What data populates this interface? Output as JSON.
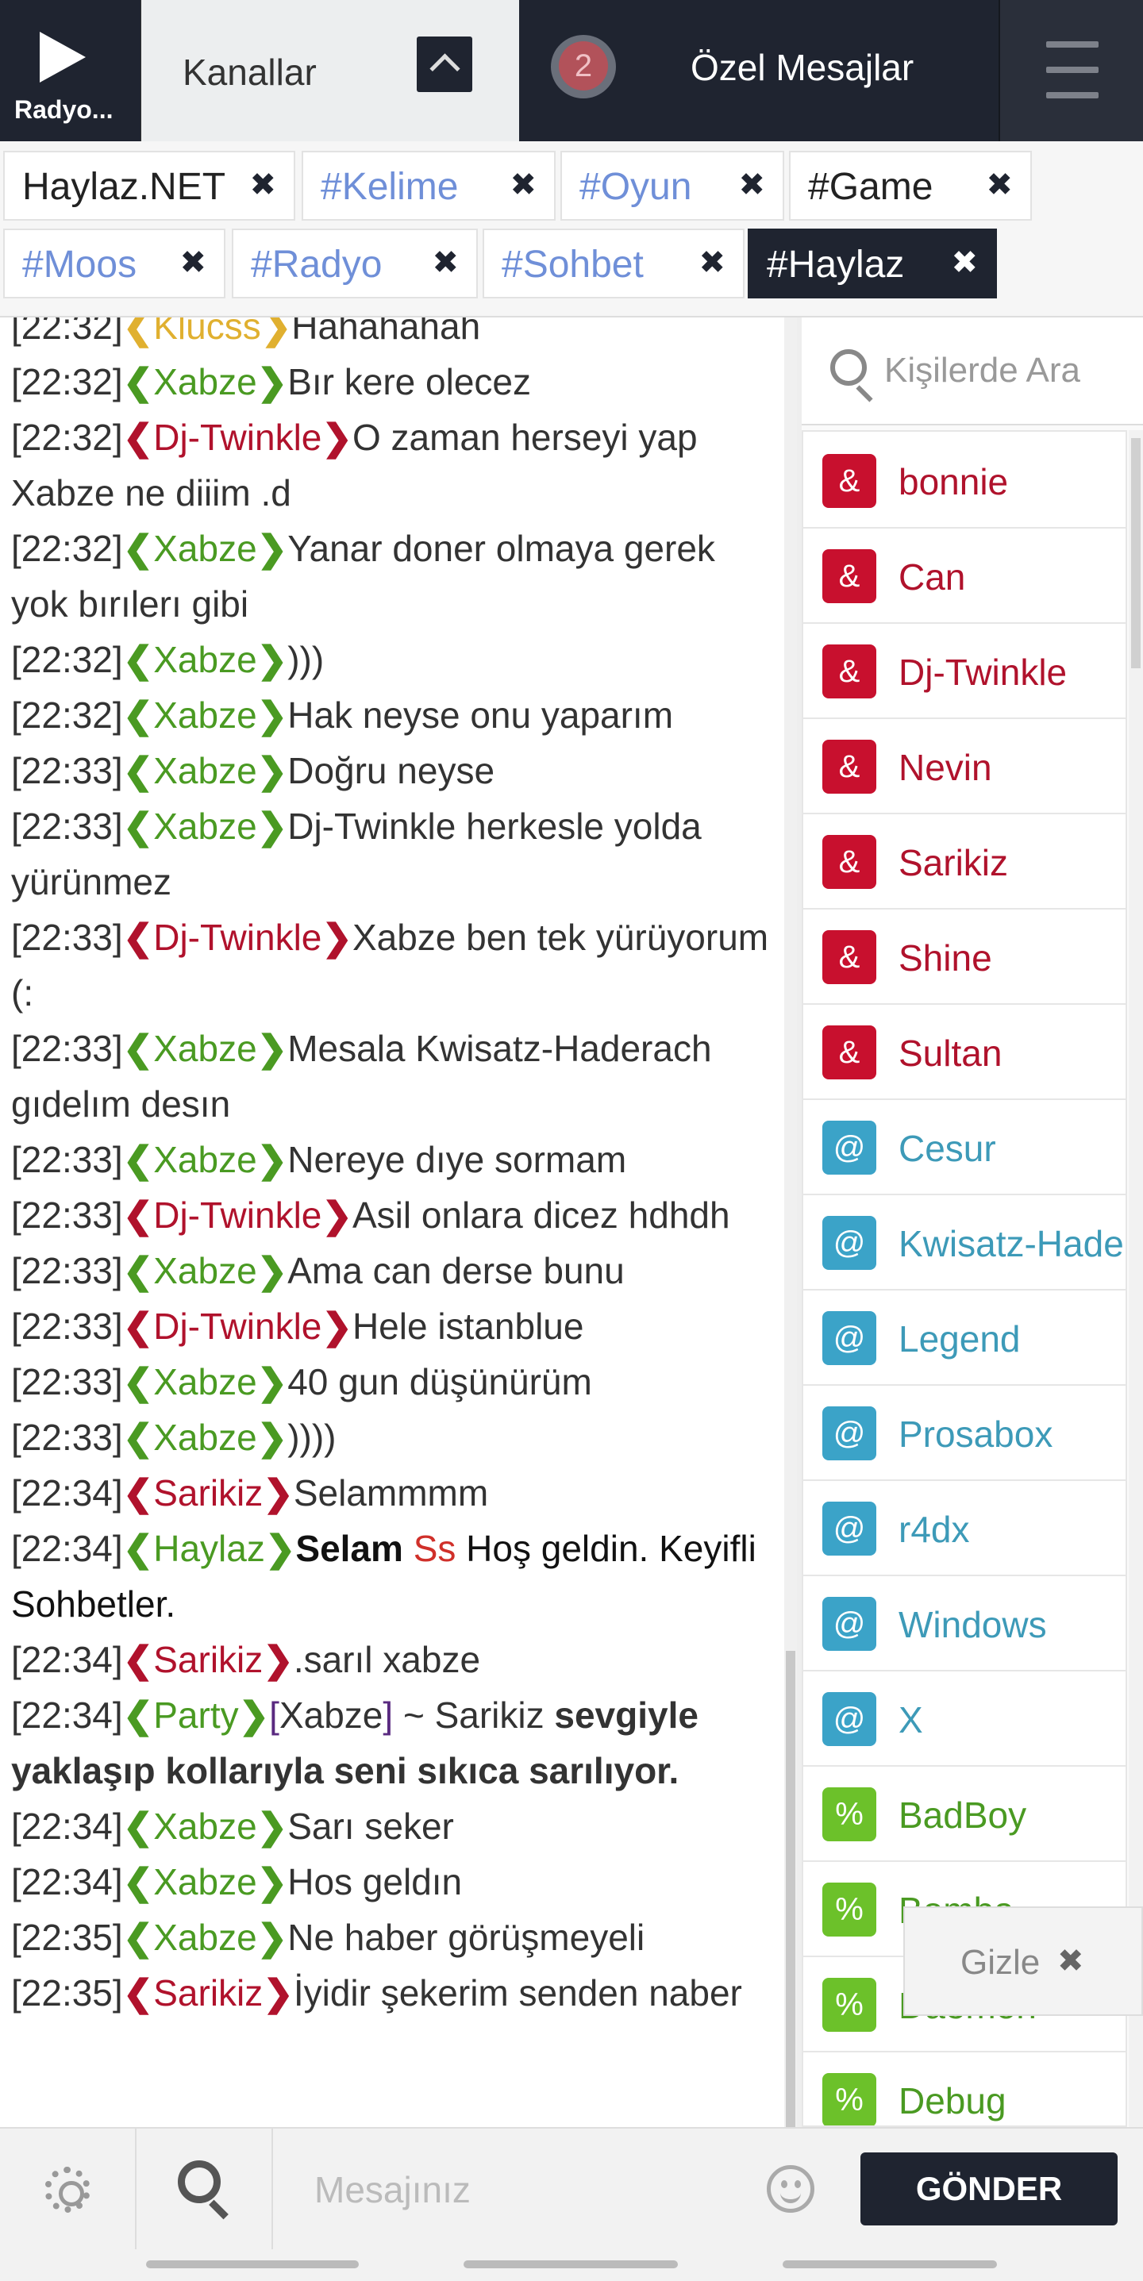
{
  "header": {
    "radio_label": "Radyo...",
    "channels_label": "Kanallar",
    "pm_badge": "2",
    "pm_label": "Özel Mesajlar"
  },
  "channel_tabs": [
    {
      "name": "Haylaz.NET",
      "close": "✖",
      "color": "#222222",
      "active": false
    },
    {
      "name": "#Kelime",
      "close": "✖",
      "color": "#6f8fd8",
      "active": false
    },
    {
      "name": "#Oyun",
      "close": "✖",
      "color": "#6f8fd8",
      "active": false
    },
    {
      "name": "#Game",
      "close": "✖",
      "color": "#222222",
      "active": false
    },
    {
      "name": "#Moos",
      "close": "✖",
      "color": "#6f8fd8",
      "active": false
    },
    {
      "name": "#Radyo",
      "close": "✖",
      "color": "#6f8fd8",
      "active": false
    },
    {
      "name": "#Sohbet",
      "close": "✖",
      "color": "#6f8fd8",
      "active": false
    },
    {
      "name": "#Haylaz",
      "close": "✖",
      "color": "#ffffff",
      "active": true
    }
  ],
  "messages": [
    {
      "time": "[22:32]",
      "nick": "Klucss",
      "nick_color": "yellow",
      "text": "Hahahahah"
    },
    {
      "time": "[22:32]",
      "nick": "Xabze",
      "nick_color": "green",
      "text": "Bır kere olecez"
    },
    {
      "time": "[22:32]",
      "nick": "Dj-Twinkle",
      "nick_color": "red",
      "text": "O zaman herseyi yap Xabze ne diiim .d"
    },
    {
      "time": "[22:32]",
      "nick": "Xabze",
      "nick_color": "green",
      "text": "Yanar doner olmaya gerek yok bırılerı gibi"
    },
    {
      "time": "[22:32]",
      "nick": "Xabze",
      "nick_color": "green",
      "text": ")))"
    },
    {
      "time": "[22:32]",
      "nick": "Xabze",
      "nick_color": "green",
      "text": "Hak neyse onu yaparım"
    },
    {
      "time": "[22:33]",
      "nick": "Xabze",
      "nick_color": "green",
      "text": "Doğru neyse"
    },
    {
      "time": "[22:33]",
      "nick": "Xabze",
      "nick_color": "green",
      "text": "Dj-Twinkle  herkesle yolda yürünmez"
    },
    {
      "time": "[22:33]",
      "nick": "Dj-Twinkle",
      "nick_color": "red",
      "text": "Xabze ben tek yürüyorum (:"
    },
    {
      "time": "[22:33]",
      "nick": "Xabze",
      "nick_color": "green",
      "text": "Mesala Kwisatz-Haderach gıdelım desın"
    },
    {
      "time": "[22:33]",
      "nick": "Xabze",
      "nick_color": "green",
      "text": "Nereye dıye sormam"
    },
    {
      "time": "[22:33]",
      "nick": "Dj-Twinkle",
      "nick_color": "red",
      "text": "Asil onlara dicez hdhdh"
    },
    {
      "time": "[22:33]",
      "nick": "Xabze",
      "nick_color": "green",
      "text": "Ama can derse bunu"
    },
    {
      "time": "[22:33]",
      "nick": "Dj-Twinkle",
      "nick_color": "red",
      "text": "Hele istanblue"
    },
    {
      "time": "[22:33]",
      "nick": "Xabze",
      "nick_color": "green",
      "text": "40 gun düşünürüm"
    },
    {
      "time": "[22:33]",
      "nick": "Xabze",
      "nick_color": "green",
      "text": "))))"
    },
    {
      "time": "[22:34]",
      "nick": "Sarikiz",
      "nick_color": "red",
      "text": "Selammmm"
    },
    {
      "time": "[22:34]",
      "nick": "Haylaz",
      "nick_color": "green",
      "bold": "Selam",
      "red": "Ss",
      "text": "Hoş geldin. Keyifli Sohbetler."
    },
    {
      "time": "[22:34]",
      "nick": "Sarikiz",
      "nick_color": "red",
      "text": ".sarıl xabze"
    },
    {
      "time": "[22:34]",
      "nick": "Party",
      "nick_color": "green",
      "target": "Xabze",
      "action": "~ Sarikiz",
      "text": "sevgiyle yaklaşıp kollarıyla seni sıkıca sarılıyor."
    },
    {
      "time": "[22:34]",
      "nick": "Xabze",
      "nick_color": "green",
      "text": "Sarı seker"
    },
    {
      "time": "[22:34]",
      "nick": "Xabze",
      "nick_color": "green",
      "text": "Hos geldın"
    },
    {
      "time": "[22:35]",
      "nick": "Xabze",
      "nick_color": "green",
      "text": "Ne haber görüşmeyeli"
    },
    {
      "time": "[22:35]",
      "nick": "Sarikiz",
      "nick_color": "red",
      "text": "İyidir şekerim senden naber"
    }
  ],
  "users_search": {
    "placeholder": "Kişilerde Ara"
  },
  "users": [
    {
      "symbol": "&",
      "name": "bonnie",
      "role": "owner"
    },
    {
      "symbol": "&",
      "name": "Can",
      "role": "owner"
    },
    {
      "symbol": "&",
      "name": "Dj-Twinkle",
      "role": "owner"
    },
    {
      "symbol": "&",
      "name": "Nevin",
      "role": "owner"
    },
    {
      "symbol": "&",
      "name": "Sarikiz",
      "role": "owner"
    },
    {
      "symbol": "&",
      "name": "Shine",
      "role": "owner"
    },
    {
      "symbol": "&",
      "name": "Sultan",
      "role": "owner"
    },
    {
      "symbol": "@",
      "name": "Cesur",
      "role": "op"
    },
    {
      "symbol": "@",
      "name": "Kwisatz-Haderach",
      "role": "op"
    },
    {
      "symbol": "@",
      "name": "Legend",
      "role": "op"
    },
    {
      "symbol": "@",
      "name": "Prosabox",
      "role": "op"
    },
    {
      "symbol": "@",
      "name": "r4dx",
      "role": "op"
    },
    {
      "symbol": "@",
      "name": "Windows",
      "role": "op"
    },
    {
      "symbol": "@",
      "name": "X",
      "role": "op"
    },
    {
      "symbol": "%",
      "name": "BadBoy",
      "role": "hop"
    },
    {
      "symbol": "%",
      "name": "Bomba",
      "role": "hop"
    },
    {
      "symbol": "%",
      "name": "Daemon",
      "role": "hop"
    },
    {
      "symbol": "%",
      "name": "Debug",
      "role": "hop"
    }
  ],
  "hide_button": {
    "label": "Gizle",
    "icon": "✖"
  },
  "input": {
    "placeholder": "Mesajınız"
  },
  "send_label": "GÖNDER"
}
